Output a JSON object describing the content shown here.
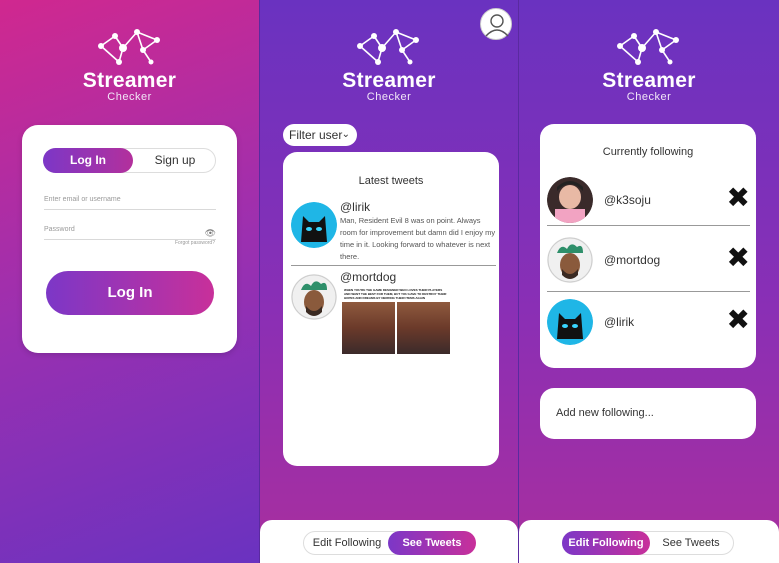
{
  "brand": {
    "name": "Streamer",
    "sub": "Checker"
  },
  "login": {
    "tab_login": "Log In",
    "tab_signup": "Sign up",
    "email_placeholder": "Enter email or username",
    "password_placeholder": "Password",
    "forgot": "Forgot password?",
    "button": "Log In"
  },
  "tweets": {
    "filter": "Filter user",
    "title": "Latest tweets",
    "items": [
      {
        "handle": "@lirik",
        "text": "Man, Resident Evil 8 was on point. Always room for improvement but damn did I enjoy my time in it. Looking forward to whatever is next there."
      },
      {
        "handle": "@mortdog",
        "meme_caption": "WHEN YOU'RE THE GAME DESIGNER WHO LOVES THEIR PLAYERS AND WANT THE BEST FOR THEM, BUT YOU HAVE TO DESTROY THEIR HOPES AND DREAMS BY NERFING THEIR ITEMS AGAIN"
      }
    ]
  },
  "nav": {
    "edit_following": "Edit Following",
    "see_tweets": "See Tweets"
  },
  "following": {
    "title": "Currently following",
    "items": [
      {
        "handle": "@k3soju"
      },
      {
        "handle": "@mortdog"
      },
      {
        "handle": "@lirik"
      }
    ],
    "remove_glyph": "✖",
    "add": "Add new following..."
  },
  "colors": {
    "accent_start": "#7c37c7",
    "accent_end": "#c8309a"
  }
}
